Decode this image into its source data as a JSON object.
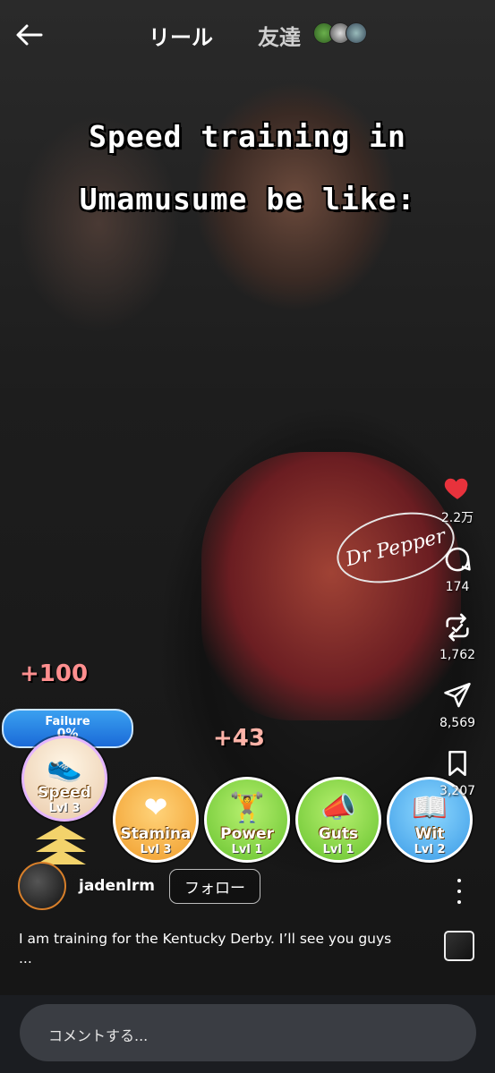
{
  "header": {
    "back_icon": "arrow-left-icon",
    "tab_reels": "リール",
    "tab_friends": "友達"
  },
  "video": {
    "caption_line1": "Speed training in",
    "caption_line2": "Umamusume be like:",
    "shirt_logo": "Dr Pepper",
    "game_overlay": {
      "plus_speed": "+100",
      "plus_other": "+43",
      "failure_label": "Failure",
      "failure_value": "0%",
      "trainings": [
        {
          "name": "Speed",
          "level": "Lvl 3"
        },
        {
          "name": "Stamina",
          "level": "Lvl 3"
        },
        {
          "name": "Power",
          "level": "Lvl 1"
        },
        {
          "name": "Guts",
          "level": "Lvl 1"
        },
        {
          "name": "Wit",
          "level": "Lvl 2"
        }
      ]
    }
  },
  "actions": {
    "like_count": "2.2万",
    "comment_count": "174",
    "repost_count": "1,762",
    "share_count": "8,569",
    "save_count": "3,207"
  },
  "post": {
    "username": "jadenlrm",
    "follow_label": "フォロー",
    "description": "I am training for the Kentucky Derby. I’ll see you guys",
    "description_more": "..."
  },
  "comment": {
    "placeholder": "コメントする..."
  },
  "colors": {
    "like": "#e8323c",
    "bottom_bar": "#1b1d21",
    "comment_field": "#3a3d43"
  }
}
